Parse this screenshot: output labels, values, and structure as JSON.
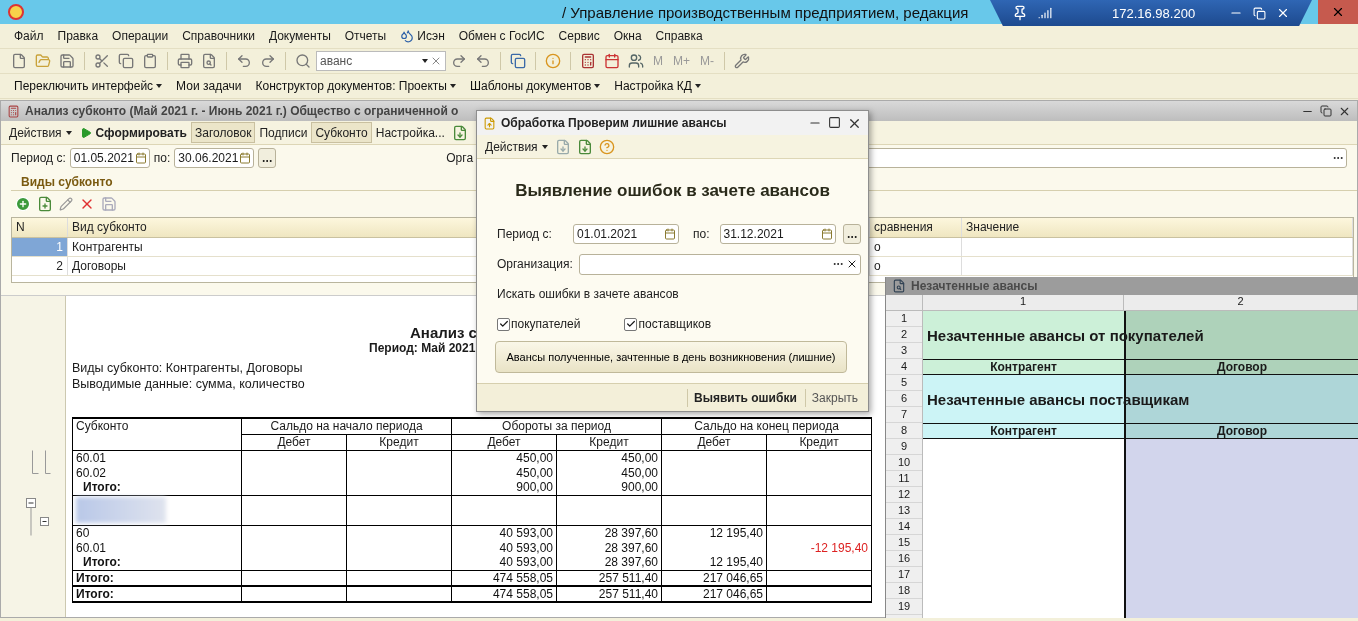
{
  "app": {
    "separator": "/",
    "title": "Управление производственным предприятием, редакция"
  },
  "remote_bar": {
    "host": "172.16.98.200"
  },
  "menu": [
    {
      "label": "Файл",
      "kind": "plain"
    },
    {
      "label": "Правка",
      "kind": "plain"
    },
    {
      "label": "Операции",
      "kind": "plain"
    },
    {
      "label": "Справочники",
      "kind": "plain"
    },
    {
      "label": "Документы",
      "kind": "plain"
    },
    {
      "label": "Отчеты",
      "kind": "plain"
    },
    {
      "label": "Исэн",
      "kind": "app"
    },
    {
      "label": "Обмен с ГосИС",
      "kind": "plain"
    },
    {
      "label": "Сервис",
      "kind": "plain"
    },
    {
      "label": "Окна",
      "kind": "plain"
    },
    {
      "label": "Справка",
      "kind": "plain"
    }
  ],
  "search": {
    "value": "аванс"
  },
  "memory_buttons": [
    "M",
    "M+",
    "M-"
  ],
  "panel": [
    {
      "label": "Переключить интерфейс",
      "dropdown": true
    },
    {
      "label": "Мои задачи",
      "dropdown": false
    },
    {
      "label": "Конструктор документов: Проекты",
      "dropdown": true
    },
    {
      "label": "Шаблоны документов",
      "dropdown": true
    },
    {
      "label": "Настройка КД",
      "dropdown": true
    }
  ],
  "report_window": {
    "title": "Анализ субконто (Май 2021 г. - Июнь 2021 г.) Общество с ограниченной о",
    "toolbar": [
      {
        "label": "Действия",
        "kind": "menu",
        "pressed": false
      },
      {
        "label": "Сформировать",
        "kind": "run",
        "pressed": false
      },
      {
        "label": "Заголовок",
        "kind": "toggle",
        "pressed": true
      },
      {
        "label": "Подписи",
        "kind": "toggle",
        "pressed": false
      },
      {
        "label": "Субконто",
        "kind": "toggle",
        "pressed": true
      },
      {
        "label": "Настройка...",
        "kind": "plain",
        "pressed": false
      }
    ],
    "period": {
      "from_label": "Период с:",
      "from": "01.05.2021",
      "to_label": "по:",
      "to": "30.06.2021"
    },
    "org_label": "Орга",
    "section_title": "Виды субконто",
    "grid": {
      "columns": [
        "N",
        "Вид субконто",
        "сравнения",
        "Значение"
      ],
      "rows": [
        {
          "n": "1",
          "name": "Контрагенты",
          "comparison": "о",
          "selected": true
        },
        {
          "n": "2",
          "name": "Договоры",
          "comparison": "о",
          "selected": false
        }
      ]
    },
    "report": {
      "title": "Анализ с",
      "period": "Период: Май 2021",
      "lines": [
        "Виды субконто: Контрагенты, Договоры",
        "Выводимые данные: сумма, количество"
      ],
      "column_groups": [
        "Субконто",
        "Сальдо на начало периода",
        "Обороты за период",
        "Сальдо на конец периода"
      ],
      "subcolumns": [
        "Дебет",
        "Кредит",
        "Дебет",
        "Кредит",
        "Дебет",
        "Кредит"
      ],
      "rows": [
        {
          "kind": "data",
          "label": "60.01",
          "turnover_debit": "450,00",
          "turnover_credit": "450,00"
        },
        {
          "kind": "data",
          "label": "60.02",
          "turnover_debit": "450,00",
          "turnover_credit": "450,00"
        },
        {
          "kind": "subtotal",
          "label": "Итого:",
          "turnover_debit": "900,00",
          "turnover_credit": "900,00"
        },
        {
          "kind": "group"
        },
        {
          "kind": "data",
          "label": "60",
          "turnover_debit": "40 593,00",
          "turnover_credit": "28 397,60",
          "closing_debit": "12 195,40"
        },
        {
          "kind": "data",
          "label": "60.01",
          "turnover_debit": "40 593,00",
          "turnover_credit": "28 397,60",
          "closing_credit": "-12 195,40",
          "negative": true
        },
        {
          "kind": "subtotal",
          "label": "Итого:",
          "turnover_debit": "40 593,00",
          "turnover_credit": "28 397,60",
          "closing_debit": "12 195,40"
        },
        {
          "kind": "total",
          "label": "Итого:",
          "turnover_debit": "474 558,05",
          "turnover_credit": "257 511,40",
          "closing_debit": "217 046,65"
        },
        {
          "kind": "grand",
          "label": "Итого:",
          "turnover_debit": "474 558,05",
          "turnover_credit": "257 511,40",
          "closing_debit": "217 046,65"
        }
      ]
    }
  },
  "dialog": {
    "title": "Обработка  Проверим лишние авансы",
    "actions": "Действия",
    "heading": "Выявление ошибок в зачете авансов",
    "period": {
      "from_label": "Период с:",
      "from": "01.01.2021",
      "to_label": "по:",
      "to": "31.12.2021"
    },
    "org_label": "Организация:",
    "group_label": "Искать ошибки в зачете авансов",
    "checkboxes": [
      {
        "label": "покупателей",
        "checked": true
      },
      {
        "label": "поставщиков",
        "checked": true
      }
    ],
    "report_button": "Авансы полученные, зачтенные в день возникновения (лишние)",
    "footer": [
      {
        "label": "Выявить ошибки",
        "kind": "default"
      },
      {
        "label": "Закрыть",
        "kind": "plain"
      }
    ]
  },
  "sheet": {
    "title": "Незачтенные авансы",
    "columns": [
      "1",
      "2"
    ],
    "row_numbers": [
      "1",
      "2",
      "3",
      "4",
      "5",
      "6",
      "7",
      "8",
      "9",
      "10",
      "11",
      "12",
      "13",
      "14",
      "15",
      "16",
      "17",
      "18",
      "19"
    ],
    "sections": [
      {
        "title": "Незачтенные авансы от покупателей",
        "headers": [
          "Контрагент",
          "Договор"
        ],
        "color": "#ccf0d8"
      },
      {
        "title": "Незачтенные авансы поставщикам",
        "headers": [
          "Контрагент",
          "Договор"
        ],
        "color": "#ccf4f6"
      }
    ]
  }
}
